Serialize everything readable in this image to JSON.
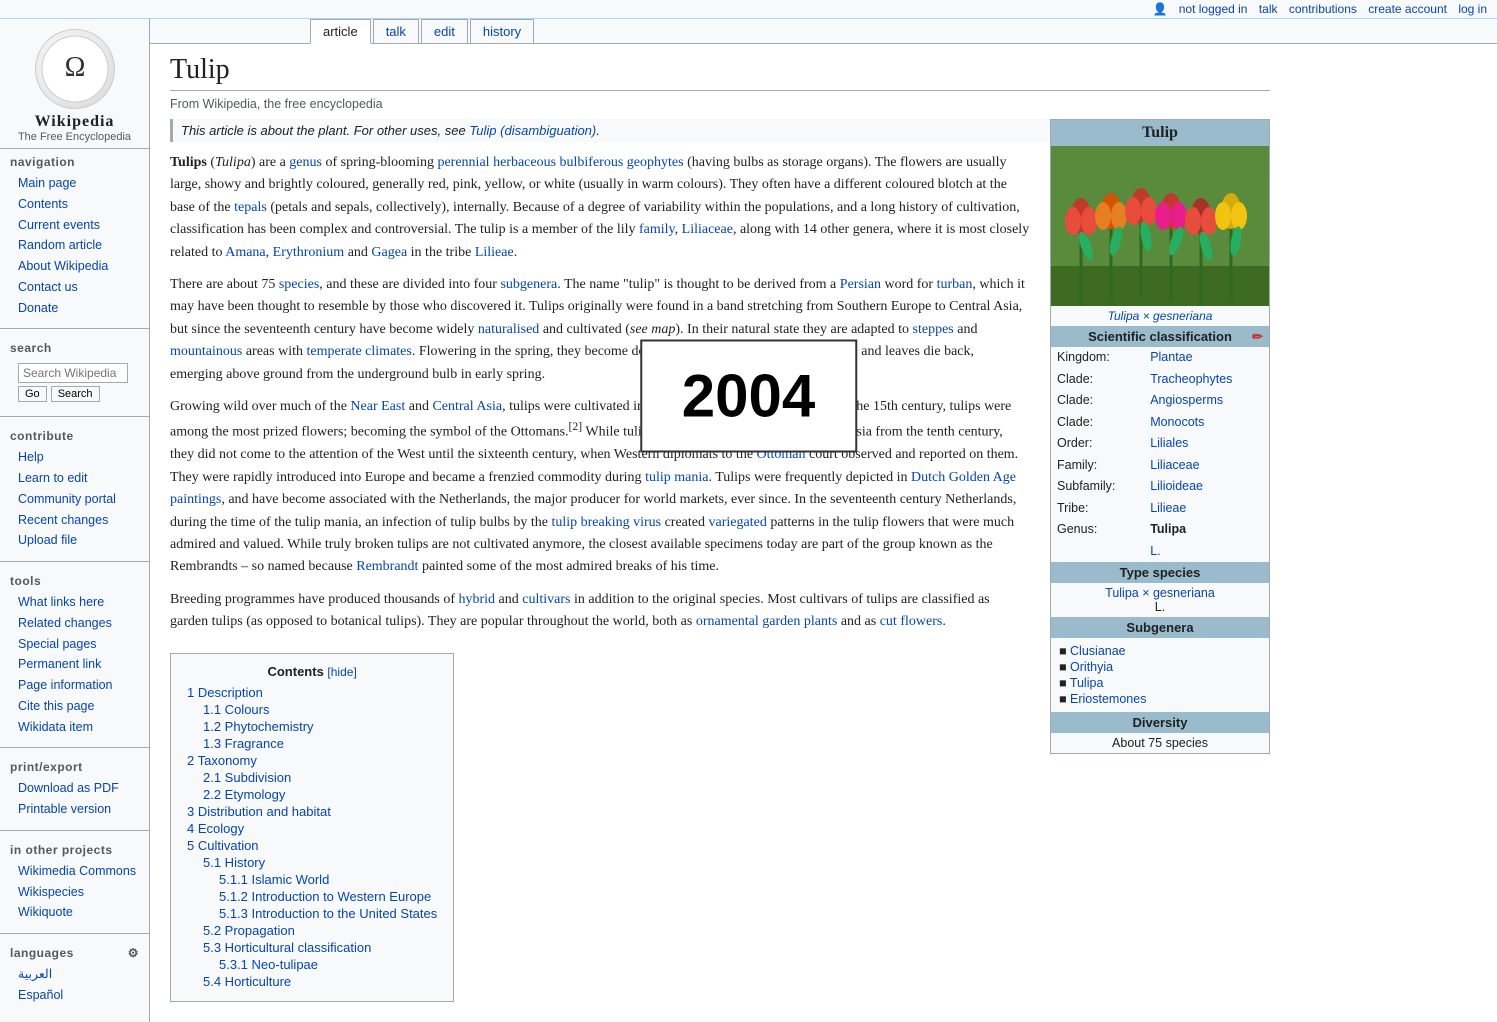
{
  "topbar": {
    "not_logged_in": "not logged in",
    "talk": "talk",
    "contributions": "contributions",
    "create_account": "create account",
    "log_in": "log in",
    "user_icon": "👤"
  },
  "logo": {
    "title": "Wikipedia",
    "subtitle": "The Free Encyclopedia"
  },
  "tabs": [
    {
      "label": "article",
      "active": true
    },
    {
      "label": "talk",
      "active": false
    },
    {
      "label": "edit",
      "active": false
    },
    {
      "label": "history",
      "active": false
    }
  ],
  "navigation": {
    "title": "navigation",
    "items": [
      {
        "label": "Main page",
        "href": "#"
      },
      {
        "label": "Contents",
        "href": "#"
      },
      {
        "label": "Current events",
        "href": "#"
      },
      {
        "label": "Random article",
        "href": "#"
      },
      {
        "label": "About Wikipedia",
        "href": "#"
      },
      {
        "label": "Contact us",
        "href": "#"
      },
      {
        "label": "Donate",
        "href": "#"
      }
    ]
  },
  "search": {
    "placeholder": "Search Wikipedia",
    "go_label": "Go",
    "search_label": "Search"
  },
  "contribute": {
    "title": "contribute",
    "items": [
      {
        "label": "Help",
        "href": "#"
      },
      {
        "label": "Learn to edit",
        "href": "#"
      },
      {
        "label": "Community portal",
        "href": "#"
      },
      {
        "label": "Recent changes",
        "href": "#"
      },
      {
        "label": "Upload file",
        "href": "#"
      }
    ]
  },
  "tools": {
    "title": "tools",
    "items": [
      {
        "label": "What links here",
        "href": "#"
      },
      {
        "label": "Related changes",
        "href": "#"
      },
      {
        "label": "Special pages",
        "href": "#"
      },
      {
        "label": "Permanent link",
        "href": "#"
      },
      {
        "label": "Page information",
        "href": "#"
      },
      {
        "label": "Cite this page",
        "href": "#"
      },
      {
        "label": "Wikidata item",
        "href": "#"
      }
    ]
  },
  "print_export": {
    "title": "print/export",
    "items": [
      {
        "label": "Download as PDF",
        "href": "#"
      },
      {
        "label": "Printable version",
        "href": "#"
      }
    ]
  },
  "other_projects": {
    "title": "in other projects",
    "items": [
      {
        "label": "Wikimedia Commons",
        "href": "#"
      },
      {
        "label": "Wikispecies",
        "href": "#"
      },
      {
        "label": "Wikiquote",
        "href": "#"
      }
    ]
  },
  "languages": {
    "title": "languages",
    "items": [
      {
        "label": "العربية"
      },
      {
        "label": "Español"
      }
    ]
  },
  "article": {
    "title": "Tulip",
    "from": "From Wikipedia, the free encyclopedia",
    "hatnote": "This article is about the plant. For other uses, see Tulip (disambiguation).",
    "hatnote_link": "Tulip (disambiguation)",
    "intro_1": "Tulips (Tulipa) are a genus of spring-blooming perennial herbaceous bulbiferous geophytes (having bulbs as storage organs). The flowers are usually large, showy and brightly coloured, generally red, pink, yellow, or white (usually in warm colours). They often have a different coloured blotch at the base of the tepals (petals and sepals, collectively), internally. Because of a degree of variability within the populations, and a long history of cultivation, classification has been complex and controversial. The tulip is a member of the lily family, Liliaceae, along with 14 other genera, where it is most closely related to Amana, Erythronium and Gagea in the tribe Lilieae.",
    "intro_2": "There are about 75 species, and these are divided into four subgenera. The name \"tulip\" is thought to be derived from a Persian word for turban, which it may have been thought to resemble by those who discovered it. Tulips originally were found in a band stretching from Southern Europe to Central Asia, but since the seventeenth century have become widely naturalised and cultivated (see map). In their natural state they are adapted to steppes and mountainous areas with temperate climates. Flowering in the spring, they become dormant in the summer once the flowers and leaves die back, emerging above ground from the underground bulb in early spring.",
    "intro_3": "Growing wild over much of the Near East and Central Asia, tulips were cultivated in Constantinople as early as 1055. By the 15th century, tulips were among the most prized flowers; becoming the symbol of the Ottomans.[2] While tulips had probably been cultivated in Persia from the tenth century, they did not come to the attention of the West until the sixteenth century, when Western diplomats to the Ottoman court observed and reported on them. They were rapidly introduced into Europe and became a frenzied commodity during tulip mania. Tulips were frequently depicted in Dutch Golden Age paintings, and have become associated with the Netherlands, the major producer for world markets, ever since. In the seventeenth century Netherlands, during the time of the tulip mania, an infection of tulip bulbs by the tulip breaking virus created variegated patterns in the tulip flowers that were much admired and valued. While truly broken tulips are not cultivated anymore, the closest available specimens today are part of the group known as the Rembrandts – so named because Rembrandt painted some of the most admired breaks of his time.",
    "intro_4": "Breeding programmes have produced thousands of hybrid and cultivars in addition to the original species. Most cultivars of tulips are classified as garden tulips (as opposed to botanical tulips). They are popular throughout the world, both as ornamental garden plants and as cut flowers."
  },
  "toc": {
    "title": "Contents",
    "hide_label": "hide",
    "items": [
      {
        "num": "1",
        "label": "Description",
        "sub": [
          {
            "num": "1.1",
            "label": "Colours"
          },
          {
            "num": "1.2",
            "label": "Phytochemistry"
          },
          {
            "num": "1.3",
            "label": "Fragrance"
          }
        ]
      },
      {
        "num": "2",
        "label": "Taxonomy",
        "sub": [
          {
            "num": "2.1",
            "label": "Subdivision"
          },
          {
            "num": "2.2",
            "label": "Etymology"
          }
        ]
      },
      {
        "num": "3",
        "label": "Distribution and habitat"
      },
      {
        "num": "4",
        "label": "Ecology"
      },
      {
        "num": "5",
        "label": "Cultivation",
        "sub": [
          {
            "num": "5.1",
            "label": "History",
            "sub2": [
              {
                "num": "5.1.1",
                "label": "Islamic World"
              },
              {
                "num": "5.1.2",
                "label": "Introduction to Western Europe"
              },
              {
                "num": "5.1.3",
                "label": "Introduction to the United States"
              }
            ]
          },
          {
            "num": "5.2",
            "label": "Propagation"
          },
          {
            "num": "5.3",
            "label": "Horticultural classification",
            "sub2": [
              {
                "num": "5.3.1",
                "label": "Neo-tulipae"
              }
            ]
          },
          {
            "num": "5.4",
            "label": "Horticulture"
          }
        ]
      }
    ]
  },
  "infobox": {
    "title": "Tulip",
    "image_caption": "Tulipa × gesneriana",
    "sci_title": "Scientific classification",
    "rows": [
      {
        "label": "Kingdom:",
        "value": "Plantae",
        "link": true
      },
      {
        "label": "Clade:",
        "value": "Tracheophytes",
        "link": true
      },
      {
        "label": "Clade:",
        "value": "Angiosperms",
        "link": true
      },
      {
        "label": "Clade:",
        "value": "Monocots",
        "link": true
      },
      {
        "label": "Order:",
        "value": "Liliales",
        "link": true
      },
      {
        "label": "Family:",
        "value": "Liliaceae",
        "link": true
      },
      {
        "label": "Subfamily:",
        "value": "Lilioideae",
        "link": true
      },
      {
        "label": "Tribe:",
        "value": "Lilieae",
        "link": true
      },
      {
        "label": "Genus:",
        "value": "Tulipa",
        "link": false,
        "bold": true
      },
      {
        "label": "",
        "value": "L.",
        "link": false
      }
    ],
    "type_species_title": "Type species",
    "type_species": "Tulipa × gesneriana",
    "type_species_sub": "L.",
    "subgenera_title": "Subgenera",
    "subgenera": [
      "Clusianae",
      "Orithyia",
      "Tulipa",
      "Eriostemones"
    ],
    "diversity_title": "Diversity",
    "diversity": "About 75 species"
  },
  "year_overlay": "2004"
}
